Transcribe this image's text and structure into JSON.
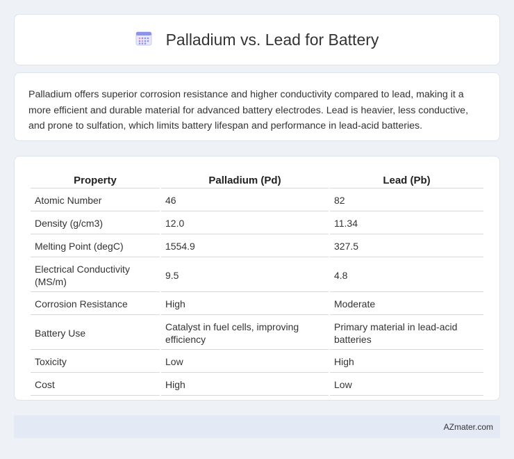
{
  "header": {
    "title": "Palladium vs. Lead for Battery",
    "icon": "calendar-icon"
  },
  "description": "Palladium offers superior corrosion resistance and higher conductivity compared to lead, making it a more efficient and durable material for advanced battery electrodes. Lead is heavier, less conductive, and prone to sulfation, which limits battery lifespan and performance in lead-acid batteries.",
  "table": {
    "headers": [
      "Property",
      "Palladium (Pd)",
      "Lead (Pb)"
    ],
    "rows": [
      [
        "Atomic Number",
        "46",
        "82"
      ],
      [
        "Density (g/cm3)",
        "12.0",
        "11.34"
      ],
      [
        "Melting Point (degC)",
        "1554.9",
        "327.5"
      ],
      [
        "Electrical Conductivity (MS/m)",
        "9.5",
        "4.8"
      ],
      [
        "Corrosion Resistance",
        "High",
        "Moderate"
      ],
      [
        "Battery Use",
        "Catalyst in fuel cells, improving efficiency",
        "Primary material in lead-acid batteries"
      ],
      [
        "Toxicity",
        "Low",
        "High"
      ],
      [
        "Cost",
        "High",
        "Low"
      ]
    ]
  },
  "footer": {
    "brand": "AZmater.com"
  }
}
